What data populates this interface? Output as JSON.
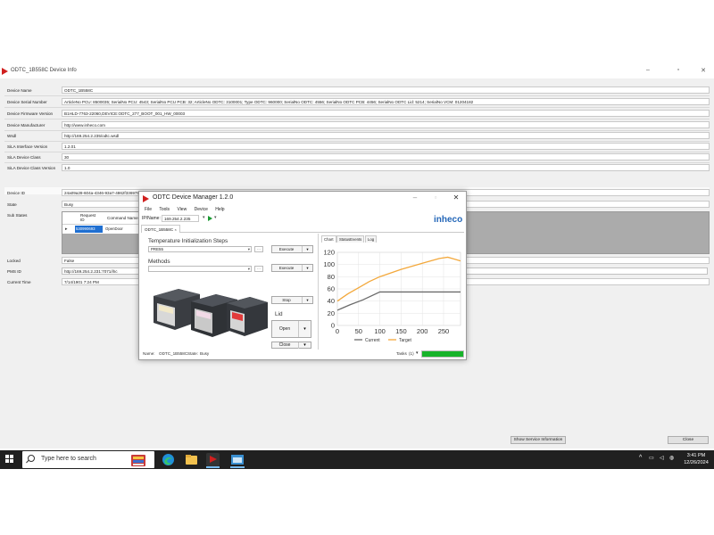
{
  "device_info": {
    "title": "ODTC_1B558C Device Info",
    "fields": [
      {
        "label": "Device Name",
        "value": "ODTC_1B558C"
      },
      {
        "label": "Device Serial Number",
        "value": "ArticleNo PCU: 8500035; SerialNo PCU: 4543; SerialNo PCU PCB: 32; ArticleNo ODTC: 3100001; Type ODTC: 960000; SerialNo ODTC: 4556; SerialNo ODTC PCB: 4456; SerialNo ODTC Lid: 5214; SerialNo VCM: 01204182"
      },
      {
        "label": "Device Firmware Version",
        "value": "B1HLD-7763-22060,DEVICE:ODTC_277_BOOT_001_HW_00003"
      },
      {
        "label": "Device Manufacturer",
        "value": "http://www.inheco.com"
      },
      {
        "label": "Wsdl",
        "value": "http://169.254.2.235/odtc.wsdl"
      },
      {
        "label": "SiLA Interface Version",
        "value": "1.2.01"
      },
      {
        "label": "SiLA Device Class",
        "value": "30"
      },
      {
        "label": "SiLA Device Class Version",
        "value": "1.0"
      }
    ],
    "device_id": {
      "label": "Device ID",
      "value": "24a09a28-604a-4346-93a7-4862f336979f"
    },
    "state": {
      "label": "State",
      "value": "Busy"
    },
    "sub_states": {
      "label": "Sub States",
      "columns": [
        "Request ID",
        "Command Name"
      ],
      "rows": [
        {
          "request_id": "530990693",
          "command_name": "OpenDoor"
        }
      ]
    },
    "locked": {
      "label": "Locked",
      "value": "False"
    },
    "pms_id": {
      "label": "PMS ID",
      "value": "http://169.254.2.231:7071/ihc"
    },
    "current_time": {
      "label": "Current Time",
      "value": "7/14/1901 7:24 PM"
    },
    "show_service_button": "Show Service Information",
    "close_button": "Close"
  },
  "device_manager": {
    "title": "ODTC Device Manager 1.2.0",
    "menu": [
      "File",
      "Tools",
      "View",
      "Device",
      "Help"
    ],
    "ip_label": "IP/Name:",
    "ip_value": "169.254.2.235",
    "brand": "inheco",
    "tab": "ODTC_1B558C",
    "temp_steps": {
      "heading": "Temperature Initialization Steps",
      "selected": "PRE55",
      "execute": "Execute"
    },
    "methods": {
      "heading": "Methods",
      "selected": "",
      "execute": "Execute"
    },
    "stop_button": "Stop",
    "lid": {
      "heading": "Lid",
      "open": "Open",
      "close": "Close"
    },
    "chart_tabs": [
      "Chart",
      "StatusEvents",
      "Log"
    ],
    "status": {
      "name_label": "Name:",
      "name": "ODTC_1B558C",
      "state_label": "State:",
      "state": "Busy",
      "tasks_label": "Tasks",
      "tasks_value": "(1)",
      "progress": 1.0
    },
    "colors": {
      "current": "#6b6b6b",
      "target": "#f3a83b",
      "progress": "#17b32a",
      "accent": "#d0201f",
      "brand": "#2467b8"
    }
  },
  "chart_data": {
    "type": "line",
    "x_ticks": [
      0,
      50,
      100,
      150,
      200,
      250
    ],
    "y_ticks": [
      0,
      20,
      40,
      60,
      80,
      100,
      120
    ],
    "xlim": [
      0,
      290
    ],
    "ylim": [
      0,
      120
    ],
    "legend": "bottom",
    "series": [
      {
        "name": "Current",
        "x": [
          0,
          30,
          60,
          100,
          150,
          200,
          250,
          290
        ],
        "y": [
          25,
          34,
          42,
          55,
          55,
          55,
          55,
          55
        ]
      },
      {
        "name": "Target",
        "x": [
          0,
          25,
          50,
          75,
          100,
          150,
          200,
          240,
          260,
          275,
          290
        ],
        "y": [
          40,
          52,
          62,
          72,
          80,
          92,
          102,
          110,
          112,
          109,
          106
        ]
      }
    ]
  },
  "taskbar": {
    "search_placeholder": "Type here to search",
    "time": "3:41 PM",
    "date": "12/26/2024"
  }
}
